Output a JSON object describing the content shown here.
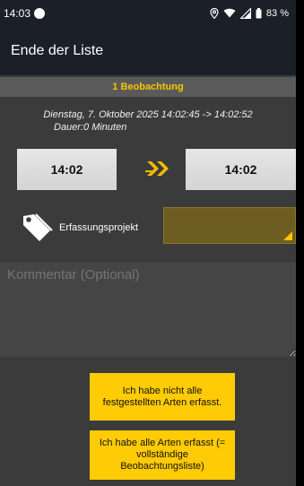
{
  "status_bar": {
    "time": "14:03",
    "battery": "83 %"
  },
  "app_bar": {
    "title": "Ende der Liste"
  },
  "observation": {
    "count_label": "1 Beobachtung",
    "date_range": "Dienstag, 7. Oktober 2025 14:02:45 -> 14:02:52",
    "duration": "Dauer:0 Minuten",
    "start_time": "14:02",
    "end_time": "14:02"
  },
  "project": {
    "label": "Erfassungsprojekt",
    "selected_value": ""
  },
  "comment": {
    "placeholder": "Kommentar (Optional)",
    "value": ""
  },
  "actions": {
    "incomplete_label": "Ich habe nicht alle festgestellten Arten erfasst.",
    "complete_label": "Ich habe alle Arten erfasst (= vollständige Beobachtungsliste)"
  },
  "colors": {
    "accent": "#ffcb05",
    "header_bg": "#1b1f28",
    "content_bg": "#3b3b3b"
  },
  "icons": {
    "location": "location-icon",
    "wifi": "wifi-icon",
    "signal": "signal-icon",
    "battery": "battery-icon",
    "arrow": "double-arrow-right-icon",
    "tag": "tag-icon"
  }
}
